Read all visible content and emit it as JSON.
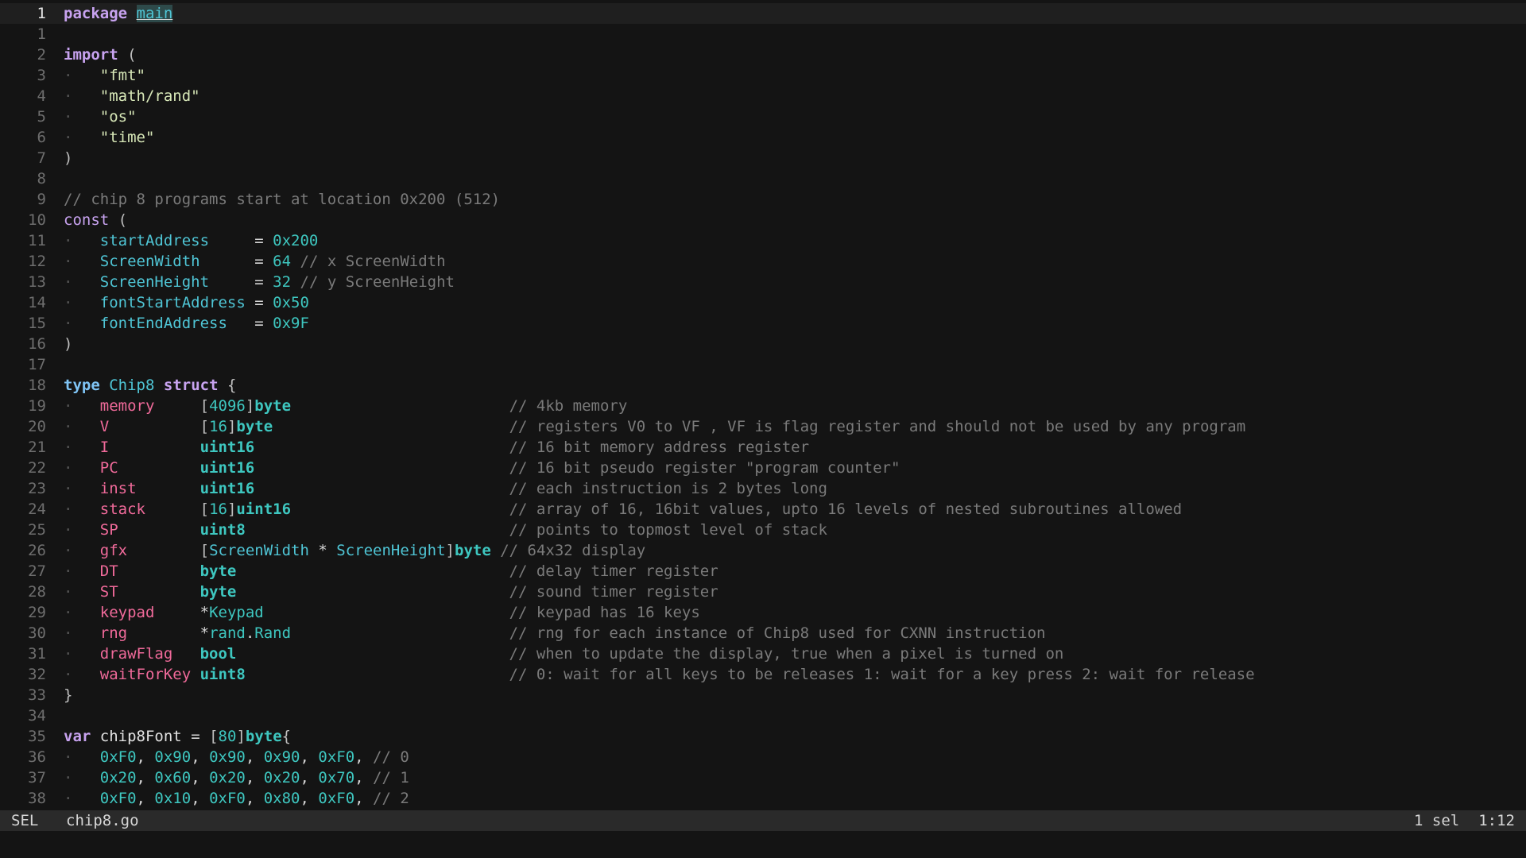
{
  "statusbar": {
    "mode": "SEL",
    "filename": "chip8.go",
    "selections": "1 sel",
    "cursor": "1:12"
  },
  "editor": {
    "current_line_index": 0,
    "lines": [
      {
        "num": "1",
        "tokens": [
          [
            "kw",
            "package"
          ],
          [
            "plain",
            " "
          ],
          [
            "pkg-main",
            "main"
          ]
        ]
      },
      {
        "num": "1",
        "tokens": []
      },
      {
        "num": "2",
        "tokens": [
          [
            "kw",
            "import"
          ],
          [
            "plain",
            " "
          ],
          [
            "bracket",
            "("
          ]
        ]
      },
      {
        "num": "3",
        "tokens": [
          [
            "indent",
            "·   "
          ],
          [
            "str",
            "\"fmt\""
          ]
        ]
      },
      {
        "num": "4",
        "tokens": [
          [
            "indent",
            "·   "
          ],
          [
            "str",
            "\"math/rand\""
          ]
        ]
      },
      {
        "num": "5",
        "tokens": [
          [
            "indent",
            "·   "
          ],
          [
            "str",
            "\"os\""
          ]
        ]
      },
      {
        "num": "6",
        "tokens": [
          [
            "indent",
            "·   "
          ],
          [
            "str",
            "\"time\""
          ]
        ]
      },
      {
        "num": "7",
        "tokens": [
          [
            "bracket",
            ")"
          ]
        ]
      },
      {
        "num": "8",
        "tokens": []
      },
      {
        "num": "9",
        "tokens": [
          [
            "com",
            "// chip 8 programs start at location 0x200 (512)"
          ]
        ]
      },
      {
        "num": "10",
        "tokens": [
          [
            "keyword",
            "const"
          ],
          [
            "plain",
            " "
          ],
          [
            "bracket",
            "("
          ]
        ]
      },
      {
        "num": "11",
        "tokens": [
          [
            "indent",
            "·   "
          ],
          [
            "const",
            "startAddress"
          ],
          [
            "plain",
            "     "
          ],
          [
            "op",
            "="
          ],
          [
            "plain",
            " "
          ],
          [
            "num",
            "0x200"
          ]
        ]
      },
      {
        "num": "12",
        "tokens": [
          [
            "indent",
            "·   "
          ],
          [
            "const",
            "ScreenWidth"
          ],
          [
            "plain",
            "      "
          ],
          [
            "op",
            "="
          ],
          [
            "plain",
            " "
          ],
          [
            "num",
            "64"
          ],
          [
            "plain",
            " "
          ],
          [
            "com",
            "// x ScreenWidth"
          ]
        ]
      },
      {
        "num": "13",
        "tokens": [
          [
            "indent",
            "·   "
          ],
          [
            "const",
            "ScreenHeight"
          ],
          [
            "plain",
            "     "
          ],
          [
            "op",
            "="
          ],
          [
            "plain",
            " "
          ],
          [
            "num",
            "32"
          ],
          [
            "plain",
            " "
          ],
          [
            "com",
            "// y ScreenHeight"
          ]
        ]
      },
      {
        "num": "14",
        "tokens": [
          [
            "indent",
            "·   "
          ],
          [
            "const",
            "fontStartAddress"
          ],
          [
            "plain",
            " "
          ],
          [
            "op",
            "="
          ],
          [
            "plain",
            " "
          ],
          [
            "num",
            "0x50"
          ]
        ]
      },
      {
        "num": "15",
        "tokens": [
          [
            "indent",
            "·   "
          ],
          [
            "const",
            "fontEndAddress"
          ],
          [
            "plain",
            "   "
          ],
          [
            "op",
            "="
          ],
          [
            "plain",
            " "
          ],
          [
            "num",
            "0x9F"
          ]
        ]
      },
      {
        "num": "16",
        "tokens": [
          [
            "bracket",
            ")"
          ]
        ]
      },
      {
        "num": "17",
        "tokens": []
      },
      {
        "num": "18",
        "tokens": [
          [
            "ty-kw",
            "type"
          ],
          [
            "plain",
            " "
          ],
          [
            "ident",
            "Chip8"
          ],
          [
            "plain",
            " "
          ],
          [
            "kw",
            "struct"
          ],
          [
            "plain",
            " "
          ],
          [
            "bracket",
            "{"
          ]
        ]
      },
      {
        "num": "19",
        "tokens": [
          [
            "indent",
            "·   "
          ],
          [
            "field",
            "memory"
          ],
          [
            "plain",
            "     "
          ],
          [
            "bracket",
            "["
          ],
          [
            "num",
            "4096"
          ],
          [
            "bracket",
            "]"
          ],
          [
            "type",
            "byte"
          ],
          [
            "plain",
            "                        "
          ],
          [
            "com",
            "// 4kb memory"
          ]
        ]
      },
      {
        "num": "20",
        "tokens": [
          [
            "indent",
            "·   "
          ],
          [
            "field",
            "V"
          ],
          [
            "plain",
            "          "
          ],
          [
            "bracket",
            "["
          ],
          [
            "num",
            "16"
          ],
          [
            "bracket",
            "]"
          ],
          [
            "type",
            "byte"
          ],
          [
            "plain",
            "                          "
          ],
          [
            "com",
            "// registers V0 to VF , VF is flag register and should not be used by any program"
          ]
        ]
      },
      {
        "num": "21",
        "tokens": [
          [
            "indent",
            "·   "
          ],
          [
            "field",
            "I"
          ],
          [
            "plain",
            "          "
          ],
          [
            "type",
            "uint16"
          ],
          [
            "plain",
            "                            "
          ],
          [
            "com",
            "// 16 bit memory address register"
          ]
        ]
      },
      {
        "num": "22",
        "tokens": [
          [
            "indent",
            "·   "
          ],
          [
            "field",
            "PC"
          ],
          [
            "plain",
            "         "
          ],
          [
            "type",
            "uint16"
          ],
          [
            "plain",
            "                            "
          ],
          [
            "com",
            "// 16 bit pseudo register \"program counter\""
          ]
        ]
      },
      {
        "num": "23",
        "tokens": [
          [
            "indent",
            "·   "
          ],
          [
            "field",
            "inst"
          ],
          [
            "plain",
            "       "
          ],
          [
            "type",
            "uint16"
          ],
          [
            "plain",
            "                            "
          ],
          [
            "com",
            "// each instruction is 2 bytes long"
          ]
        ]
      },
      {
        "num": "24",
        "tokens": [
          [
            "indent",
            "·   "
          ],
          [
            "field",
            "stack"
          ],
          [
            "plain",
            "      "
          ],
          [
            "bracket",
            "["
          ],
          [
            "num",
            "16"
          ],
          [
            "bracket",
            "]"
          ],
          [
            "type",
            "uint16"
          ],
          [
            "plain",
            "                        "
          ],
          [
            "com",
            "// array of 16, 16bit values, upto 16 levels of nested subroutines allowed"
          ]
        ]
      },
      {
        "num": "25",
        "tokens": [
          [
            "indent",
            "·   "
          ],
          [
            "field",
            "SP"
          ],
          [
            "plain",
            "         "
          ],
          [
            "type",
            "uint8"
          ],
          [
            "plain",
            "                             "
          ],
          [
            "com",
            "// points to topmost level of stack"
          ]
        ]
      },
      {
        "num": "26",
        "tokens": [
          [
            "indent",
            "·   "
          ],
          [
            "field",
            "gfx"
          ],
          [
            "plain",
            "        "
          ],
          [
            "bracket",
            "["
          ],
          [
            "const",
            "ScreenWidth"
          ],
          [
            "plain",
            " "
          ],
          [
            "op",
            "*"
          ],
          [
            "plain",
            " "
          ],
          [
            "const",
            "ScreenHeight"
          ],
          [
            "bracket",
            "]"
          ],
          [
            "type",
            "byte"
          ],
          [
            "plain",
            " "
          ],
          [
            "com",
            "// 64x32 display"
          ]
        ]
      },
      {
        "num": "27",
        "tokens": [
          [
            "indent",
            "·   "
          ],
          [
            "field",
            "DT"
          ],
          [
            "plain",
            "         "
          ],
          [
            "type",
            "byte"
          ],
          [
            "plain",
            "                              "
          ],
          [
            "com",
            "// delay timer register"
          ]
        ]
      },
      {
        "num": "28",
        "tokens": [
          [
            "indent",
            "·   "
          ],
          [
            "field",
            "ST"
          ],
          [
            "plain",
            "         "
          ],
          [
            "type",
            "byte"
          ],
          [
            "plain",
            "                              "
          ],
          [
            "com",
            "// sound timer register"
          ]
        ]
      },
      {
        "num": "29",
        "tokens": [
          [
            "indent",
            "·   "
          ],
          [
            "field",
            "keypad"
          ],
          [
            "plain",
            "     "
          ],
          [
            "op",
            "*"
          ],
          [
            "pkg",
            "Keypad"
          ],
          [
            "plain",
            "                           "
          ],
          [
            "com",
            "// keypad has 16 keys"
          ]
        ]
      },
      {
        "num": "30",
        "tokens": [
          [
            "indent",
            "·   "
          ],
          [
            "field",
            "rng"
          ],
          [
            "plain",
            "        "
          ],
          [
            "op",
            "*"
          ],
          [
            "pkg",
            "rand"
          ],
          [
            "op",
            "."
          ],
          [
            "pkg",
            "Rand"
          ],
          [
            "plain",
            "                        "
          ],
          [
            "com",
            "// rng for each instance of Chip8 used for CXNN instruction"
          ]
        ]
      },
      {
        "num": "31",
        "tokens": [
          [
            "indent",
            "·   "
          ],
          [
            "field",
            "drawFlag"
          ],
          [
            "plain",
            "   "
          ],
          [
            "type",
            "bool"
          ],
          [
            "plain",
            "                              "
          ],
          [
            "com",
            "// when to update the display, true when a pixel is turned on"
          ]
        ]
      },
      {
        "num": "32",
        "tokens": [
          [
            "indent",
            "·   "
          ],
          [
            "field",
            "waitForKey"
          ],
          [
            "plain",
            " "
          ],
          [
            "type",
            "uint8"
          ],
          [
            "plain",
            "                             "
          ],
          [
            "com",
            "// 0: wait for all keys to be releases 1: wait for a key press 2: wait for release"
          ]
        ]
      },
      {
        "num": "33",
        "tokens": [
          [
            "bracket",
            "}"
          ]
        ]
      },
      {
        "num": "34",
        "tokens": []
      },
      {
        "num": "35",
        "tokens": [
          [
            "kw",
            "var"
          ],
          [
            "plain",
            " "
          ],
          [
            "var",
            "chip8Font"
          ],
          [
            "plain",
            " "
          ],
          [
            "op",
            "="
          ],
          [
            "plain",
            " "
          ],
          [
            "bracket",
            "["
          ],
          [
            "num",
            "80"
          ],
          [
            "bracket",
            "]"
          ],
          [
            "type",
            "byte"
          ],
          [
            "bracket",
            "{"
          ]
        ]
      },
      {
        "num": "36",
        "tokens": [
          [
            "indent",
            "·   "
          ],
          [
            "num",
            "0xF0"
          ],
          [
            "op",
            ", "
          ],
          [
            "num",
            "0x90"
          ],
          [
            "op",
            ", "
          ],
          [
            "num",
            "0x90"
          ],
          [
            "op",
            ", "
          ],
          [
            "num",
            "0x90"
          ],
          [
            "op",
            ", "
          ],
          [
            "num",
            "0xF0"
          ],
          [
            "op",
            ", "
          ],
          [
            "com",
            "// 0"
          ]
        ]
      },
      {
        "num": "37",
        "tokens": [
          [
            "indent",
            "·   "
          ],
          [
            "num",
            "0x20"
          ],
          [
            "op",
            ", "
          ],
          [
            "num",
            "0x60"
          ],
          [
            "op",
            ", "
          ],
          [
            "num",
            "0x20"
          ],
          [
            "op",
            ", "
          ],
          [
            "num",
            "0x20"
          ],
          [
            "op",
            ", "
          ],
          [
            "num",
            "0x70"
          ],
          [
            "op",
            ", "
          ],
          [
            "com",
            "// 1"
          ]
        ]
      },
      {
        "num": "38",
        "tokens": [
          [
            "indent",
            "·   "
          ],
          [
            "num",
            "0xF0"
          ],
          [
            "op",
            ", "
          ],
          [
            "num",
            "0x10"
          ],
          [
            "op",
            ", "
          ],
          [
            "num",
            "0xF0"
          ],
          [
            "op",
            ", "
          ],
          [
            "num",
            "0x80"
          ],
          [
            "op",
            ", "
          ],
          [
            "num",
            "0xF0"
          ],
          [
            "op",
            ", "
          ],
          [
            "com",
            "// 2"
          ]
        ]
      }
    ]
  }
}
